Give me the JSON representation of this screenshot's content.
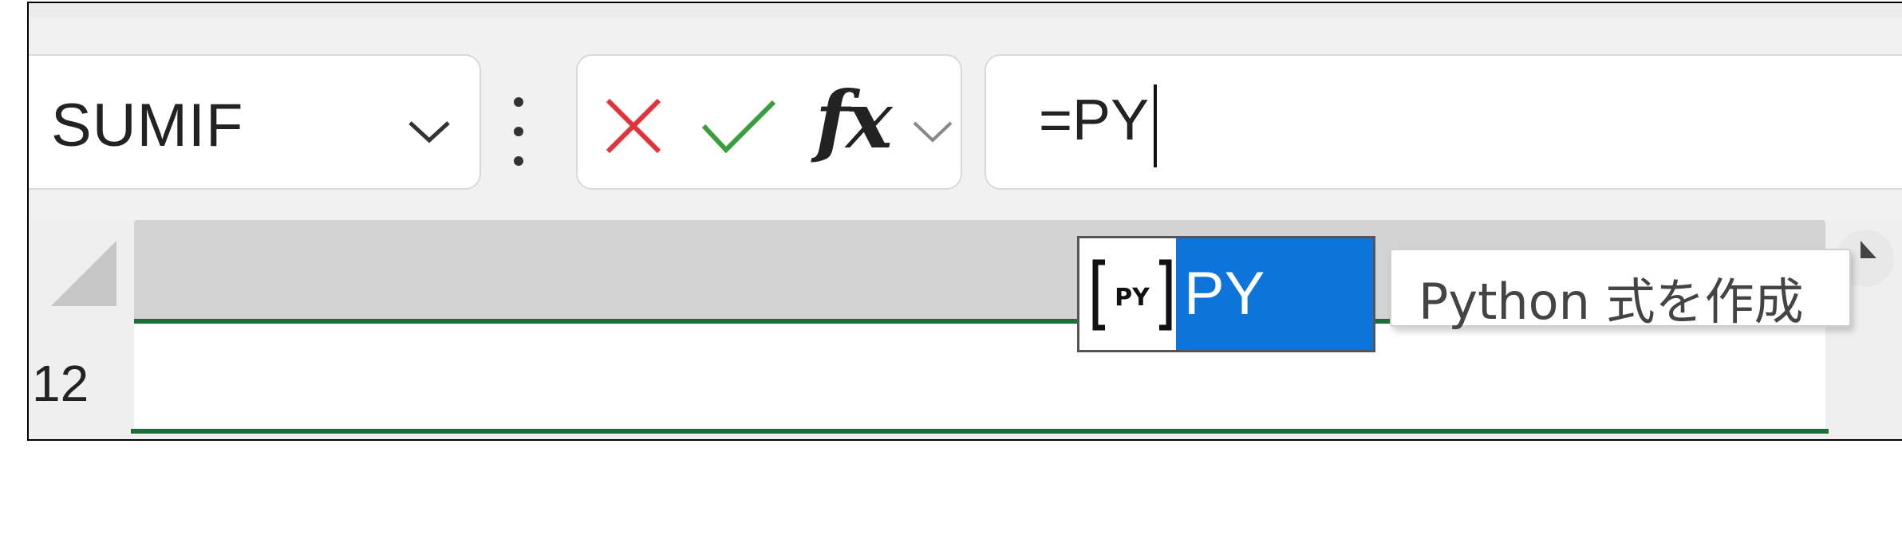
{
  "name_box": {
    "value": "SUMIF",
    "dropdown_icon": "chevron-down-icon"
  },
  "edit_buttons": {
    "cancel_icon": "close-icon",
    "enter_icon": "checkmark-icon",
    "function_label": "fx",
    "function_menu_icon": "chevron-down-icon"
  },
  "formula_bar": {
    "value": "=PY"
  },
  "grid": {
    "row_number": "12"
  },
  "autocomplete": {
    "icon": "python-icon",
    "items": [
      {
        "label": "PY",
        "selected": true
      }
    ]
  },
  "tooltip": {
    "text": "Python 式を作成"
  },
  "colors": {
    "cancel": "#e1333a",
    "enter": "#3a9e3f",
    "selection": "#0d74d9",
    "cell_border": "#1e6e3a"
  }
}
